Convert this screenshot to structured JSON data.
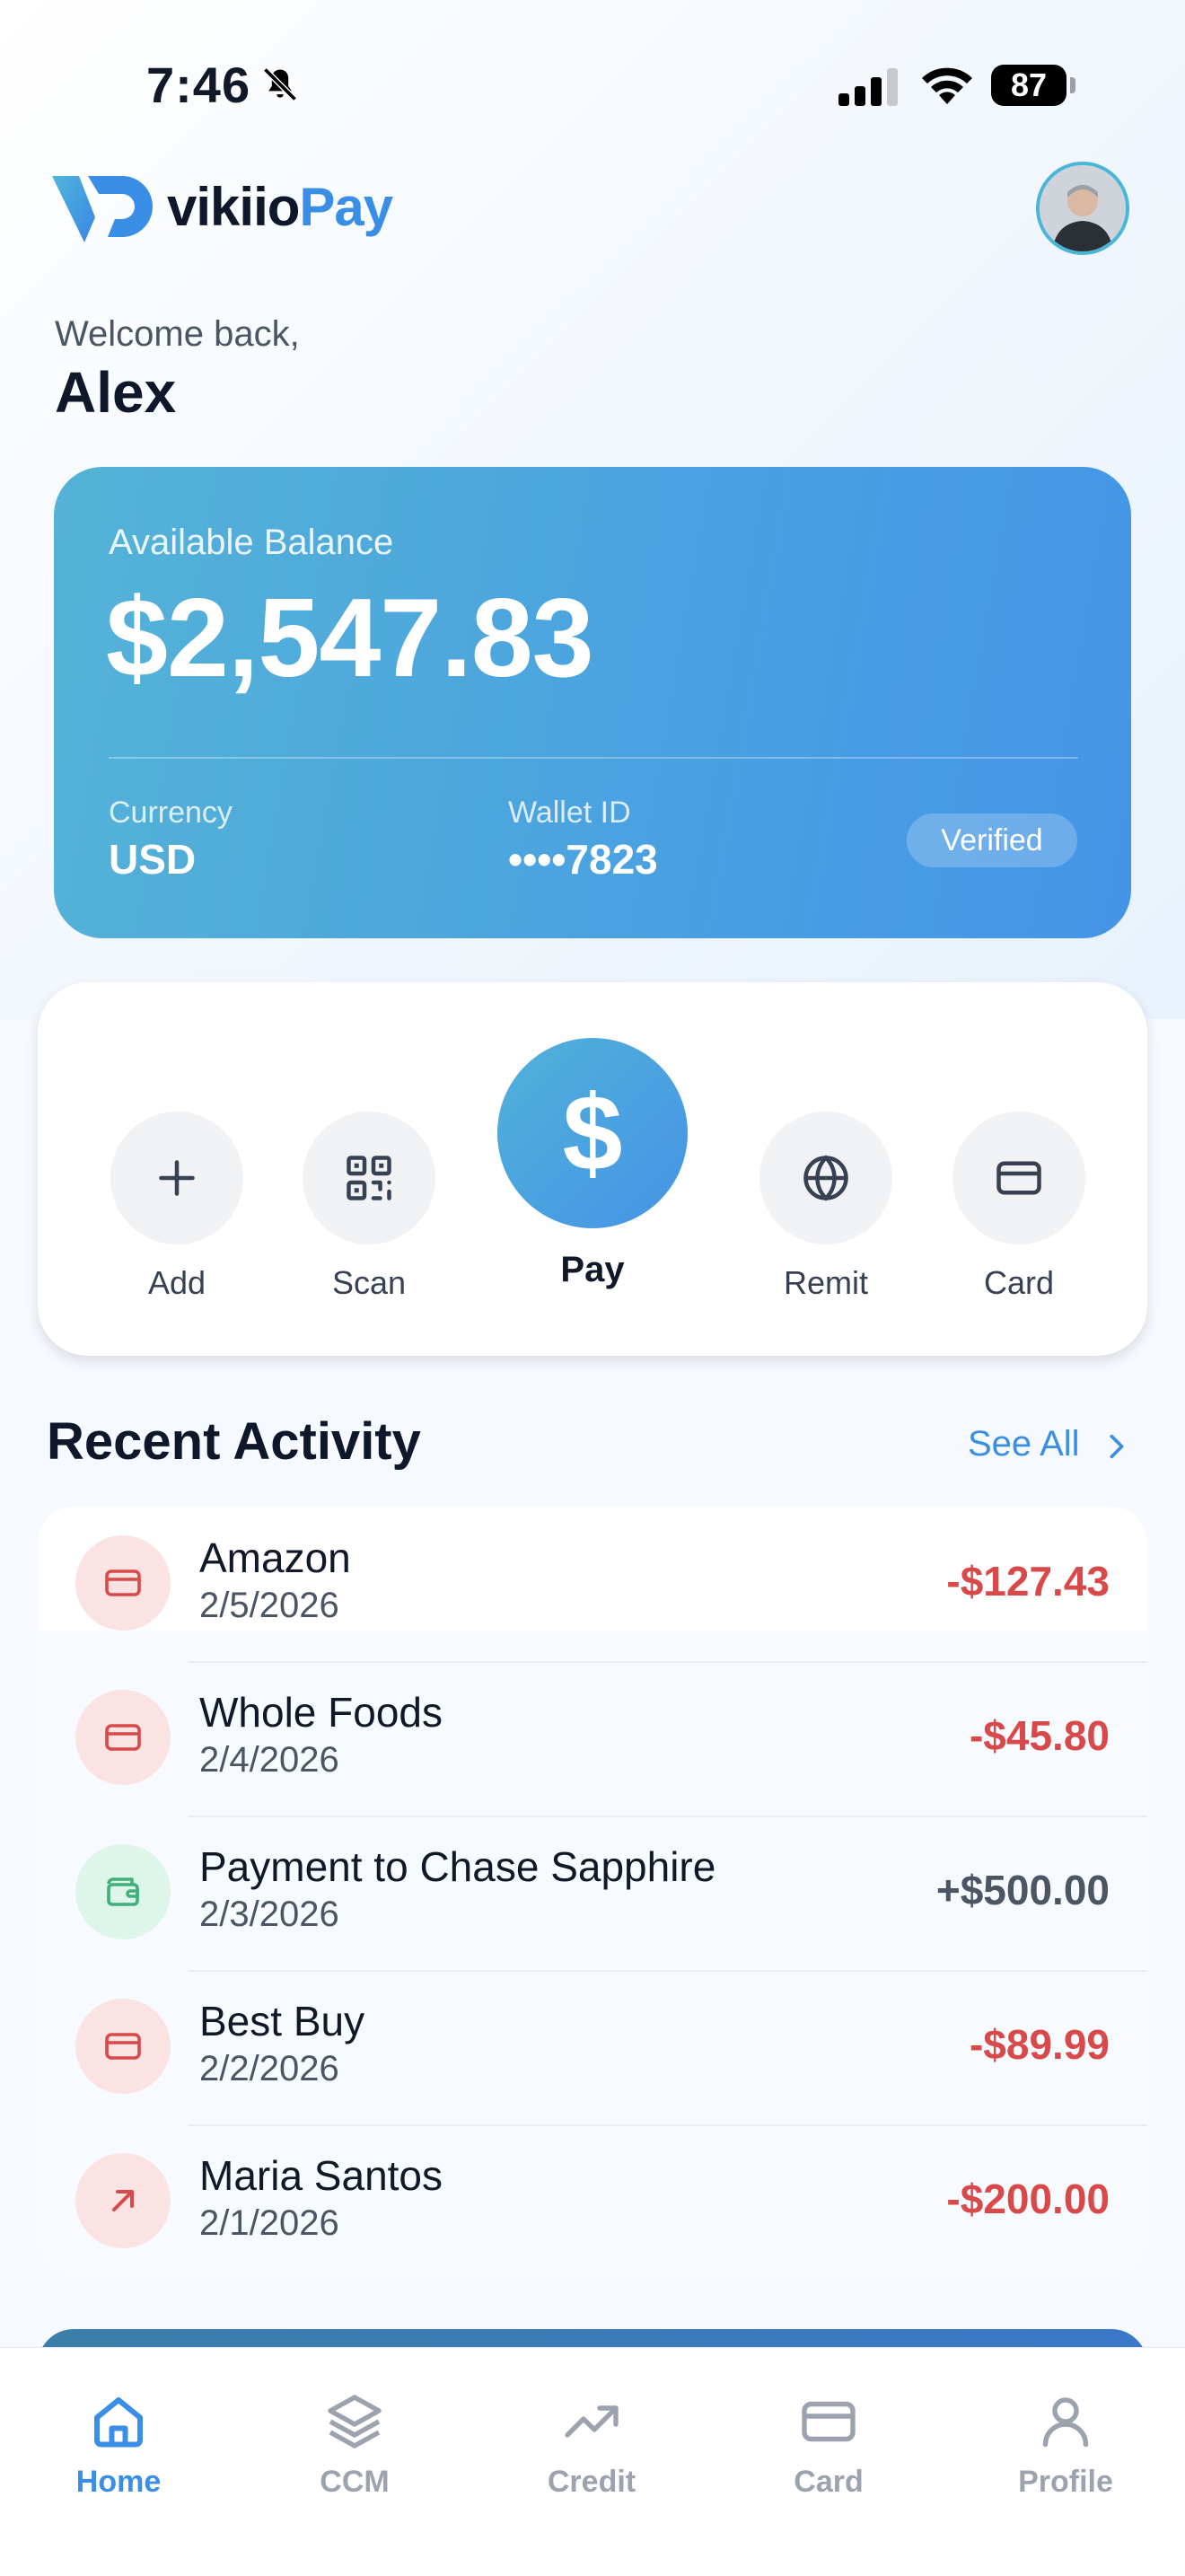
{
  "status_bar": {
    "time": "7:46",
    "battery": "87"
  },
  "header": {
    "brand_main": "vikiio",
    "brand_accent": "Pay"
  },
  "greeting": {
    "welcome": "Welcome back,",
    "name": "Alex"
  },
  "balance": {
    "label": "Available Balance",
    "amount": "$2,547.83",
    "currency_label": "Currency",
    "currency_value": "USD",
    "wallet_label": "Wallet ID",
    "wallet_value": "••••7823",
    "badge": "Verified"
  },
  "actions": [
    {
      "label": "Add",
      "icon": "plus-icon"
    },
    {
      "label": "Scan",
      "icon": "qr-code-icon"
    },
    {
      "label": "Pay",
      "icon": "dollar-icon"
    },
    {
      "label": "Remit",
      "icon": "globe-icon"
    },
    {
      "label": "Card",
      "icon": "credit-card-icon"
    }
  ],
  "recent": {
    "title": "Recent Activity",
    "see_all": "See All",
    "transactions": [
      {
        "name": "Amazon",
        "date": "2/5/2026",
        "amount": "-$127.43",
        "icon": "credit-card-icon",
        "type": "debit"
      },
      {
        "name": "Whole Foods",
        "date": "2/4/2026",
        "amount": "-$45.80",
        "icon": "credit-card-icon",
        "type": "debit"
      },
      {
        "name": "Payment to Chase Sapphire",
        "date": "2/3/2026",
        "amount": "+$500.00",
        "icon": "wallet-icon",
        "type": "credit"
      },
      {
        "name": "Best Buy",
        "date": "2/2/2026",
        "amount": "-$89.99",
        "icon": "credit-card-icon",
        "type": "debit"
      },
      {
        "name": "Maria Santos",
        "date": "2/1/2026",
        "amount": "-$200.00",
        "icon": "arrow-up-right-icon",
        "type": "debit"
      }
    ]
  },
  "tabs": [
    {
      "label": "Home",
      "icon": "home-icon",
      "active": true
    },
    {
      "label": "CCM",
      "icon": "layers-icon",
      "active": false
    },
    {
      "label": "Credit",
      "icon": "trending-up-icon",
      "active": false
    },
    {
      "label": "Card",
      "icon": "credit-card-icon",
      "active": false
    },
    {
      "label": "Profile",
      "icon": "user-icon",
      "active": false
    }
  ],
  "colors": {
    "accent": "#3b8ee6",
    "negative": "#d84a4a",
    "positive_green": "#3fb07a",
    "card_gradient_start": "#55b3d6",
    "card_gradient_end": "#4594e7"
  }
}
